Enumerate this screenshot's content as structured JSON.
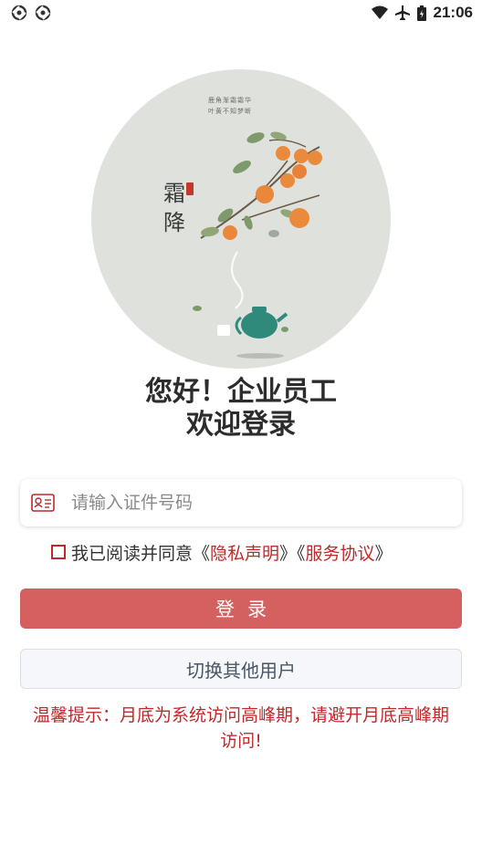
{
  "status_bar": {
    "time": "21:06",
    "left_icons": [
      "sync-icon",
      "sync-icon"
    ],
    "right_icons": [
      "wifi-icon",
      "airplane-icon",
      "battery-icon"
    ]
  },
  "hero": {
    "poem_lines": [
      "鹿角渐霜霜华",
      "叶黄不知梦断"
    ],
    "calligraphy": [
      "霜",
      "降"
    ]
  },
  "greeting": {
    "line1": "您好！企业员工",
    "line2": "欢迎登录"
  },
  "id_input": {
    "placeholder": "请输入证件号码",
    "value": "",
    "icon": "id-card-icon"
  },
  "agreement": {
    "prefix": "我已阅读并同意《",
    "privacy_link": "隐私声明",
    "middle": "》《",
    "service_link": "服务协议",
    "suffix": "》",
    "checked": false
  },
  "login_button": "登录",
  "switch_user_button": "切换其他用户",
  "tip": "温馨提示：月底为系统访问高峰期，请避开月底高峰期访问!",
  "colors": {
    "accent_red": "#c0292b",
    "login_button": "#d46060",
    "hero_bg": "#dfe2dc",
    "persimmon": "#ea8a3c"
  }
}
